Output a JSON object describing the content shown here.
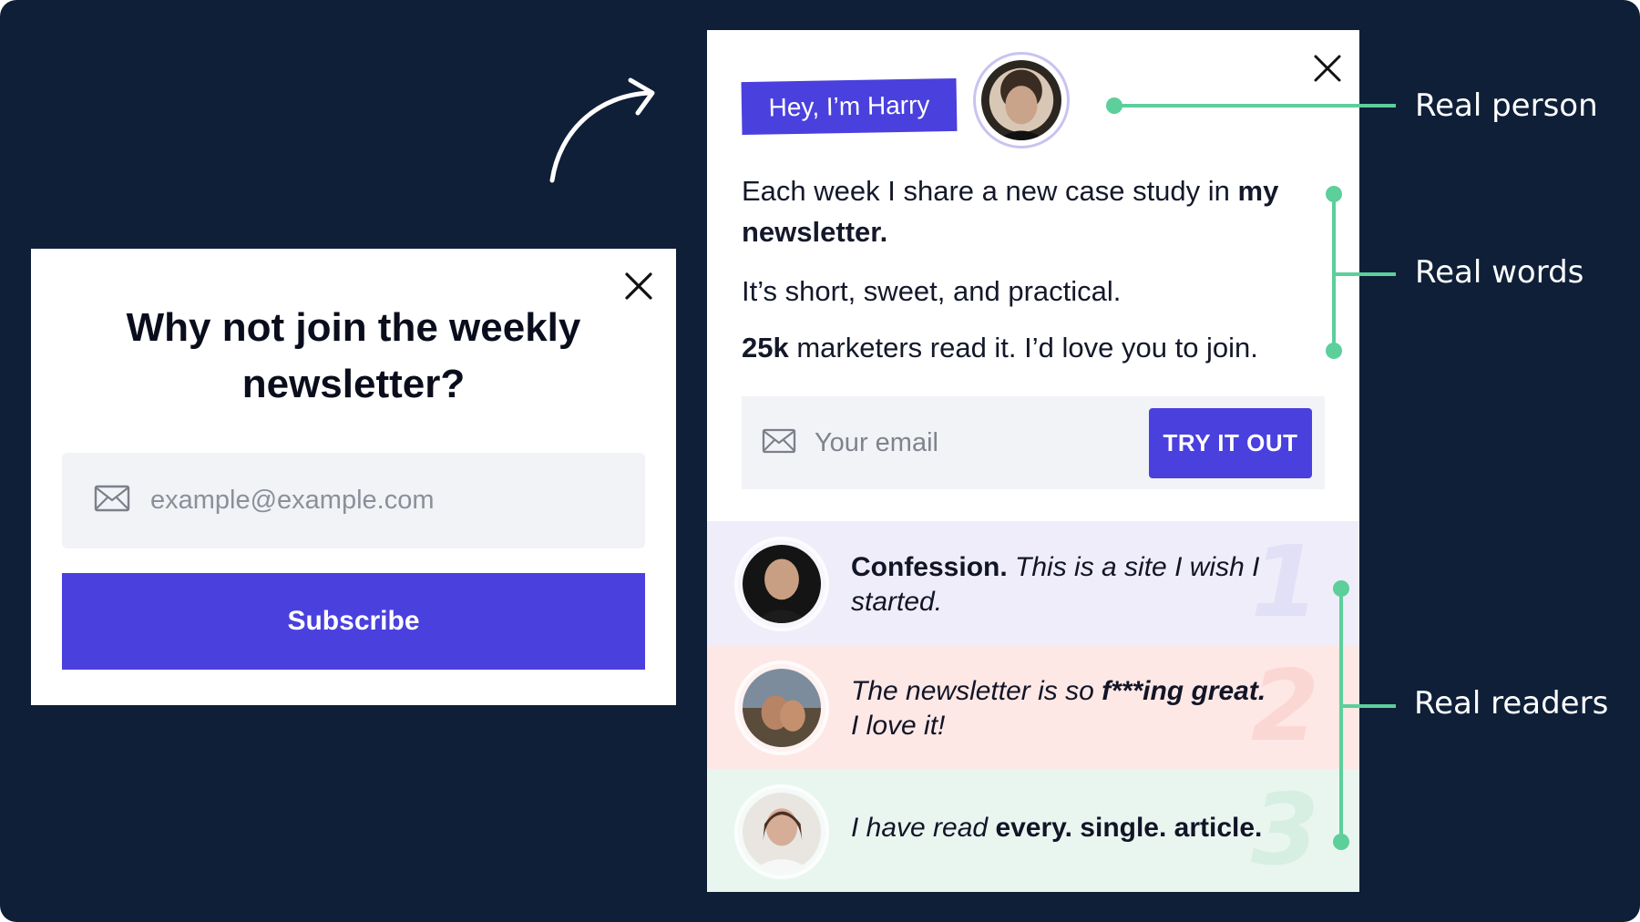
{
  "colors": {
    "background": "#0f1f38",
    "accent": "#4a40dd",
    "annotation_green": "#5ccf9a",
    "input_bg": "#f1f3f7",
    "testimonial_1_bg": "#eeedf9",
    "testimonial_2_bg": "#fde8e6",
    "testimonial_3_bg": "#e9f6f0"
  },
  "left_popup": {
    "close_icon": "close-icon",
    "title": "Why not join the weekly newsletter?",
    "email_placeholder": "example@example.com",
    "email_icon": "envelope-icon",
    "subscribe_label": "Subscribe"
  },
  "right_popup": {
    "close_icon": "close-icon",
    "greeting": "Hey, I’m Harry",
    "intro_start": "Each week I share a new case study in ",
    "intro_bold": "my newsletter.",
    "line2": "It’s short, sweet, and practical.",
    "readers_count": "25k",
    "line3_rest": " marketers read it. I’d love you to join.",
    "email_placeholder": "Your email",
    "email_icon": "envelope-icon",
    "cta_label": "TRY IT OUT",
    "testimonials": [
      {
        "number": "1",
        "bold": "Confession.",
        "italic": " This is a site I wish I started."
      },
      {
        "italic": "The newsletter is so ",
        "bold": "f***ing great.",
        "italic2": " I love it!",
        "number": "2"
      },
      {
        "italic": "I have read ",
        "bold": "every. single. article.",
        "number": "3"
      }
    ]
  },
  "annotations": {
    "real_person": "Real person",
    "real_words": "Real words",
    "real_readers": "Real readers"
  }
}
